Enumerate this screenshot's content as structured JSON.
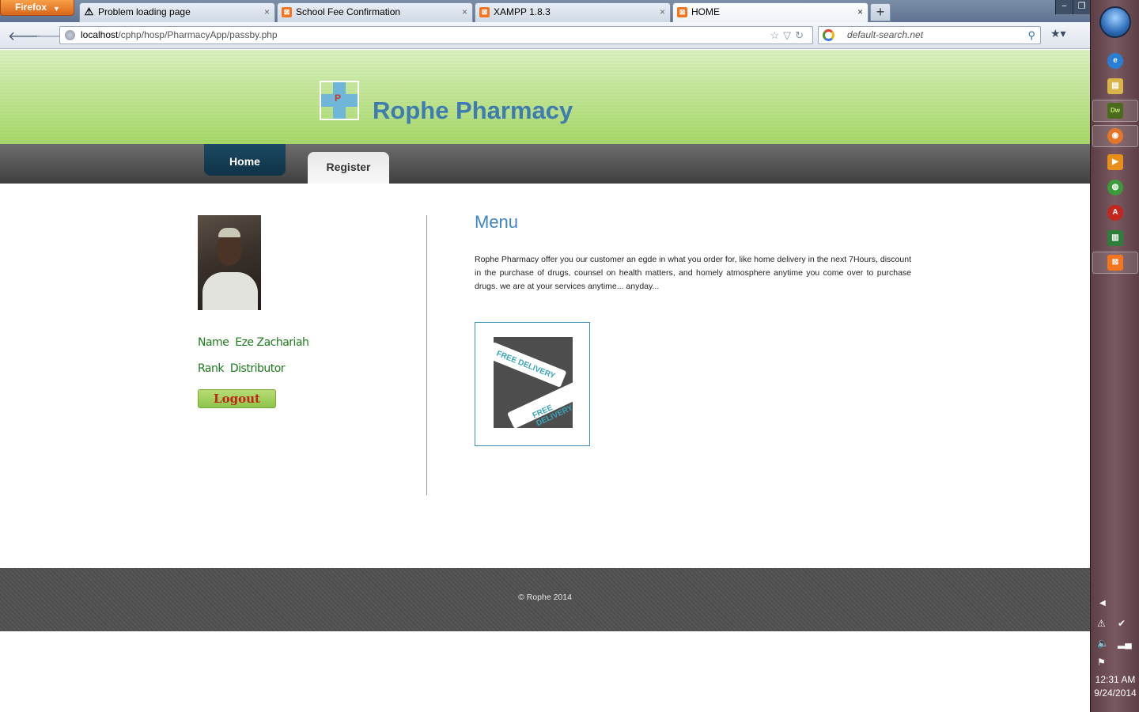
{
  "browser": {
    "app_button": "Firefox",
    "tabs": [
      {
        "label": "Problem loading page",
        "icon": "warning-icon"
      },
      {
        "label": "School Fee Confirmation",
        "icon": "xampp-icon"
      },
      {
        "label": "XAMPP 1.8.3",
        "icon": "xampp-icon"
      },
      {
        "label": "HOME",
        "icon": "xampp-icon",
        "active": true
      }
    ],
    "url_host": "localhost",
    "url_path": "/cphp/hosp/PharmacyApp/passby.php",
    "search_placeholder": "default-search.net"
  },
  "site": {
    "logo_letter": "P",
    "title": "Rophe Pharmacy",
    "nav": {
      "home": "Home",
      "register": "Register"
    },
    "user": {
      "name_label": "Name",
      "name_value": "Eze Zachariah",
      "rank_label": "Rank",
      "rank_value": "Distributor"
    },
    "logout_label": "Logout",
    "menu_heading": "Menu",
    "menu_text": "Rophe Pharmacy offer you our customer an egde in what you order for, like home delivery in the next 7Hours, discount in the purchase of drugs, counsel on health matters, and homely atmosphere anytime you come over to purchase drugs. we are at your services anytime... anyday...",
    "promo_text": [
      "FREE DELIVERY",
      "FREE DELIVERY"
    ],
    "footer": "© Rophe 2014"
  },
  "taskbar": {
    "time": "12:31 AM",
    "date": "9/24/2014",
    "pinned": [
      "ie-icon",
      "explorer-icon",
      "dreamweaver-icon",
      "firefox-icon",
      "media-player-icon",
      "chrome-icon",
      "acrobat-icon",
      "excel-icon",
      "xampp-icon"
    ]
  }
}
